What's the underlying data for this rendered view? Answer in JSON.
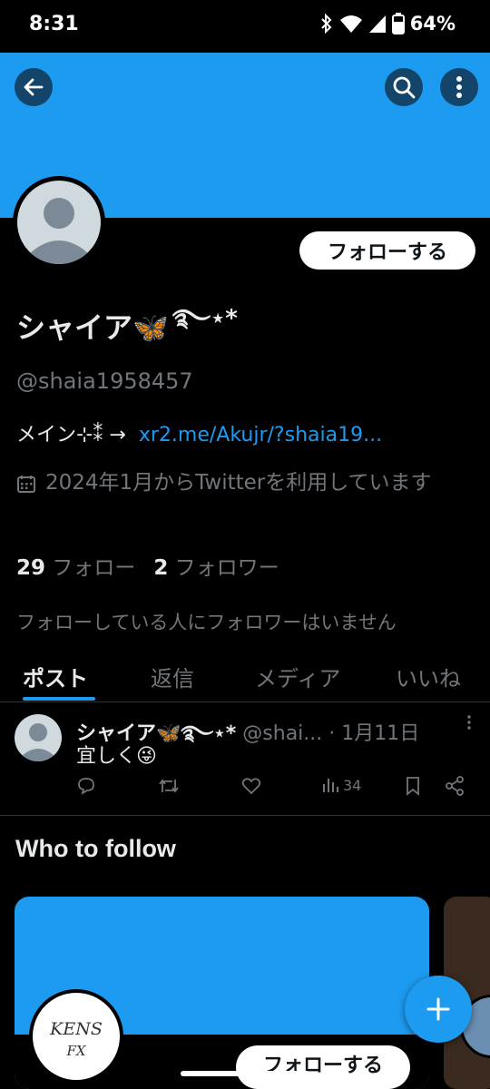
{
  "status_bar": {
    "time": "8:31",
    "battery": "64%",
    "icons": [
      "bluetooth-icon",
      "wifi-icon",
      "signal-icon",
      "battery-icon"
    ]
  },
  "colors": {
    "accent": "#1d9bf0",
    "background": "#000000",
    "text_primary": "#e7e9ea",
    "text_secondary": "#71767b"
  },
  "header": {
    "icons": [
      "back-arrow-icon",
      "search-icon",
      "more-vertical-icon"
    ]
  },
  "profile": {
    "follow_label": "フォローする",
    "display_name": "シャイア🦋",
    "name_decoration": "࿐⋆*",
    "handle": "@shaia1958457",
    "bio_text": "メイン⊹⁑ →",
    "bio_link": "xr2.me/Akujr/?shaia19...",
    "joined": "2024年1月からTwitterを利用しています",
    "following_count": "29",
    "following_label": "フォロー",
    "followers_count": "2",
    "followers_label": "フォロワー",
    "followers_note": "フォローしている人にフォロワーはいません"
  },
  "tabs": [
    {
      "label": "ポスト",
      "active": true
    },
    {
      "label": "返信",
      "active": false
    },
    {
      "label": "メディア",
      "active": false
    },
    {
      "label": "いいね",
      "active": false
    }
  ],
  "post": {
    "name": "シャイア🦋࿐⋆*",
    "meta": "@shai... · 1月11日",
    "text": "宜しく😜",
    "views": "34",
    "actions": [
      "reply-icon",
      "repost-icon",
      "like-icon",
      "views-icon",
      "bookmark-icon",
      "share-icon"
    ]
  },
  "who_to_follow": {
    "title": "Who to follow",
    "card_avatar_text_1": "KENS",
    "card_avatar_text_2": "FX",
    "card_follow_label": "フォローする"
  }
}
